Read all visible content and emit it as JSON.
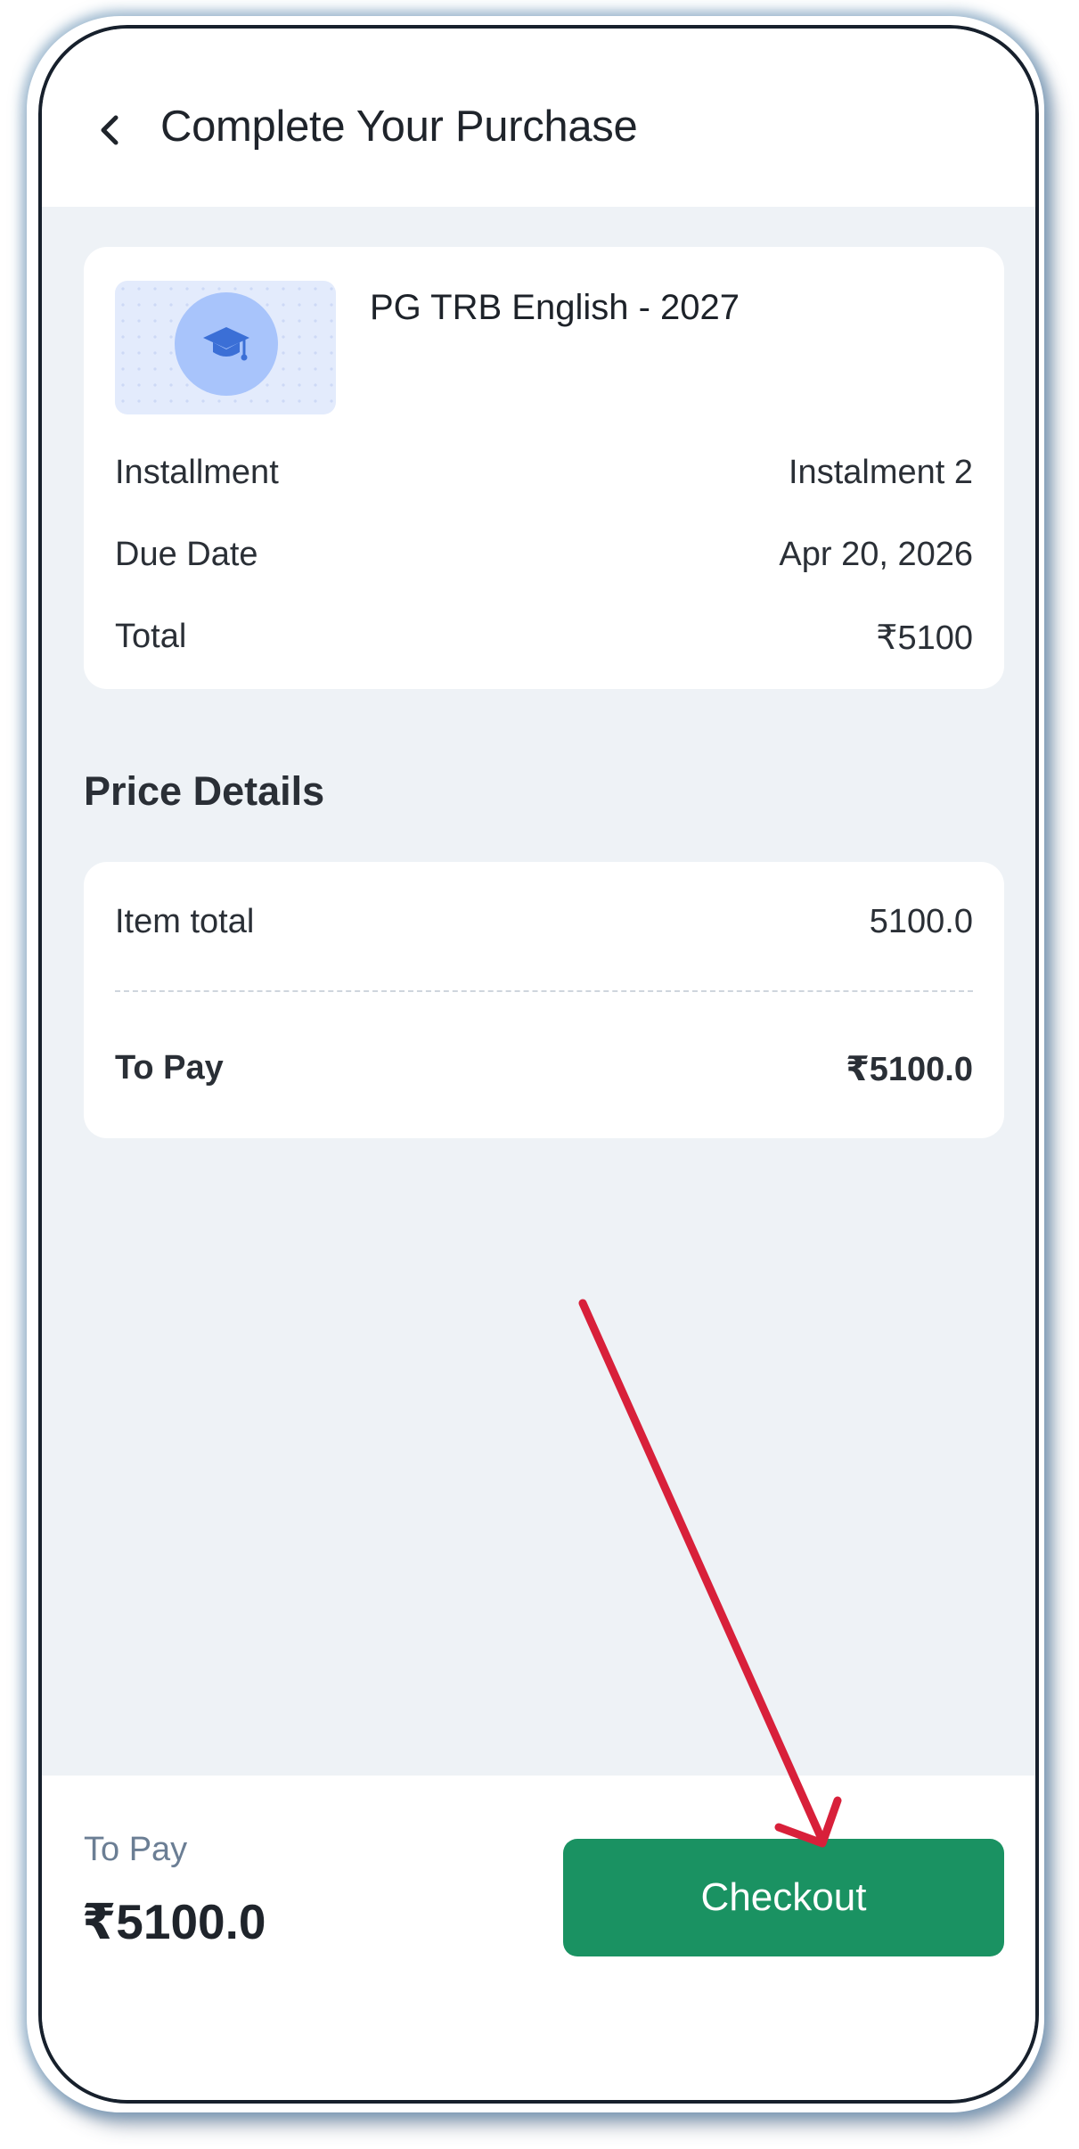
{
  "header": {
    "title": "Complete Your Purchase",
    "back_icon": "chevron-left-icon"
  },
  "product": {
    "name": "PG TRB English - 2027",
    "icon": "graduation-cap-icon",
    "rows": [
      {
        "label": "Installment",
        "value": "Instalment 2"
      },
      {
        "label": "Due Date",
        "value": "Apr 20, 2026"
      },
      {
        "label": "Total",
        "value": "₹5100"
      }
    ]
  },
  "price_details": {
    "title": "Price Details",
    "item_total_label": "Item total",
    "item_total_value": "5100.0",
    "to_pay_label": "To Pay",
    "to_pay_value": "₹5100.0"
  },
  "footer": {
    "to_pay_label": "To Pay",
    "to_pay_amount": "₹5100.0",
    "checkout_label": "Checkout"
  },
  "colors": {
    "primary_button": "#1a9262",
    "annotation_arrow": "#d8203a",
    "page_background": "#eef2f6"
  }
}
